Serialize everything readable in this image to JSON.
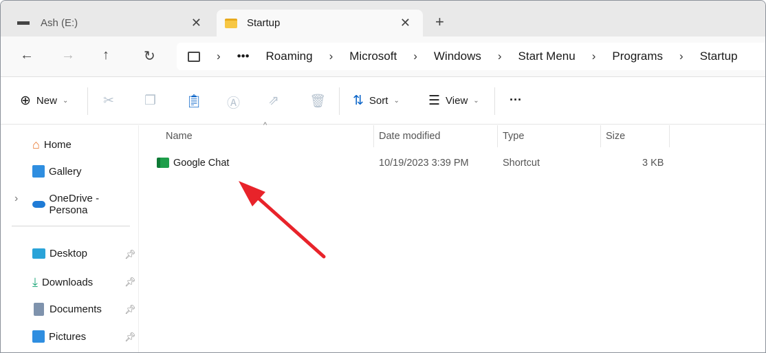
{
  "tabs": [
    {
      "label": "Ash (E:)",
      "icon": "drive-icon"
    },
    {
      "label": "Startup",
      "icon": "folder-icon",
      "active": true
    }
  ],
  "breadcrumb": [
    "Roaming",
    "Microsoft",
    "Windows",
    "Start Menu",
    "Programs",
    "Startup"
  ],
  "toolbar": {
    "new_label": "New",
    "sort_label": "Sort",
    "view_label": "View"
  },
  "sidebar": {
    "items": [
      {
        "label": "Home"
      },
      {
        "label": "Gallery"
      },
      {
        "label": "OneDrive - Persona"
      }
    ],
    "quick": [
      {
        "label": "Desktop"
      },
      {
        "label": "Downloads"
      },
      {
        "label": "Documents"
      },
      {
        "label": "Pictures"
      }
    ]
  },
  "columns": {
    "name": "Name",
    "date": "Date modified",
    "type": "Type",
    "size": "Size"
  },
  "files": [
    {
      "name": "Google Chat",
      "date": "10/19/2023 3:39 PM",
      "type": "Shortcut",
      "size": "3 KB"
    }
  ],
  "colors": {
    "arrow": "#e8232a"
  }
}
